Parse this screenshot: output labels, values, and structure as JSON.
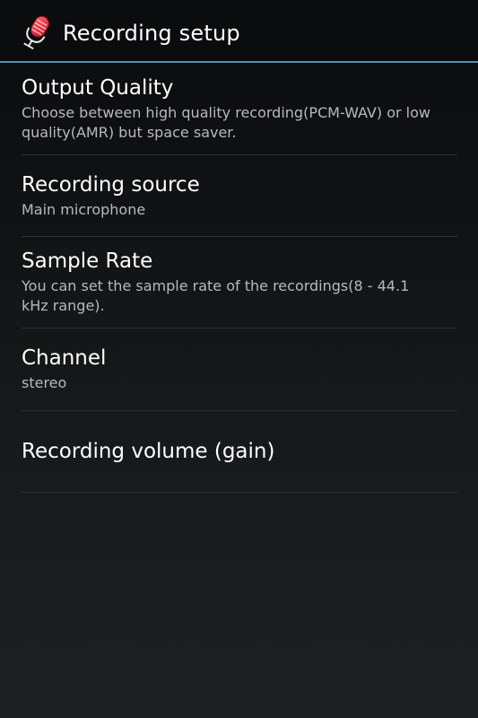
{
  "action_bar": {
    "title": "Recording setup",
    "icon": "microphone-icon",
    "accent_color": "#4b8fb8"
  },
  "preferences": [
    {
      "title": "Output Quality",
      "summary": "Choose between high quality recording(PCM-WAV) or low quality(AMR) but space saver."
    },
    {
      "title": "Recording source",
      "summary": "Main microphone"
    },
    {
      "title": "Sample Rate",
      "summary": "You can set the sample rate of the recordings(8 - 44.1 kHz range)."
    },
    {
      "title": "Channel",
      "summary": "stereo"
    },
    {
      "title": "Recording volume (gain)",
      "summary": ""
    }
  ]
}
